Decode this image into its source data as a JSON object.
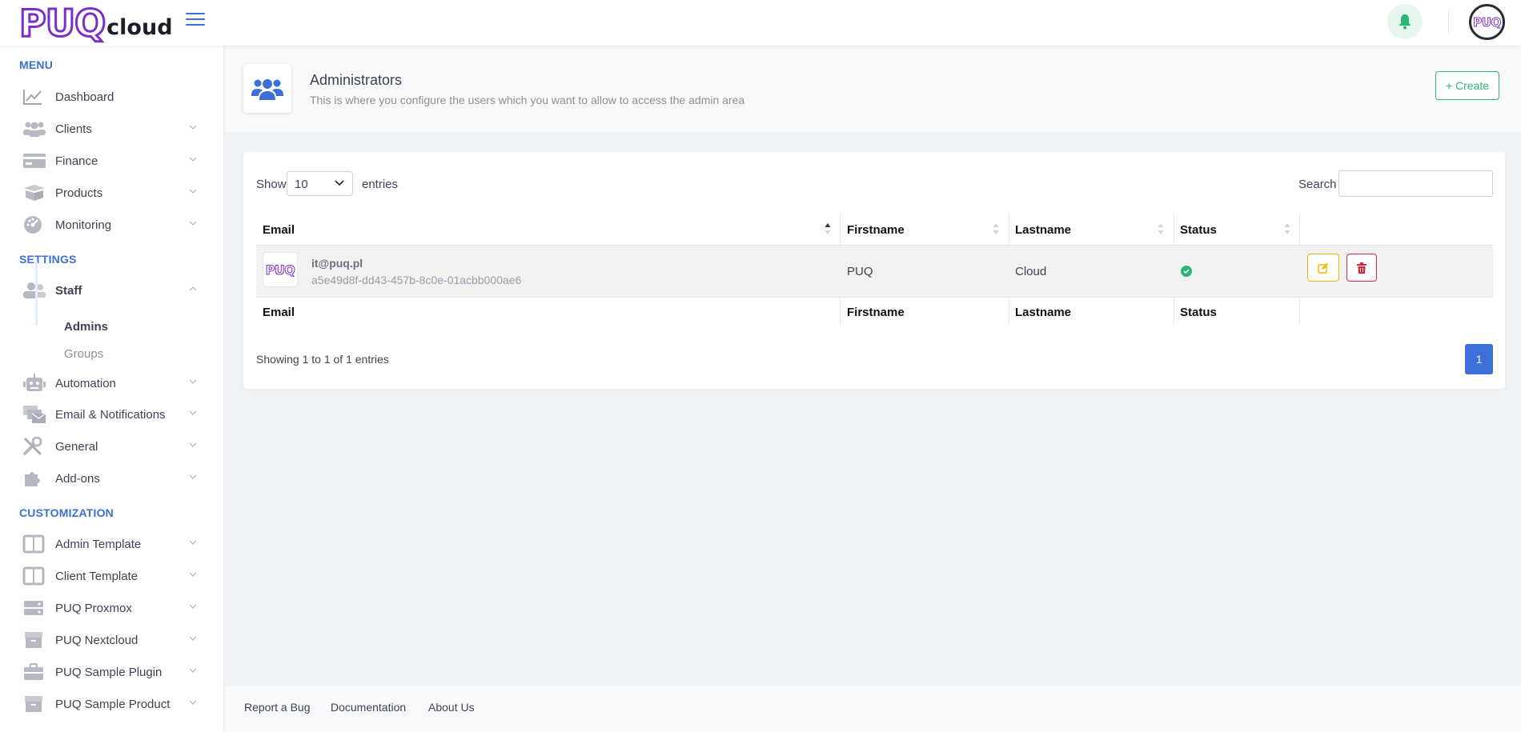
{
  "header": {
    "logo_main": "PUQ",
    "logo_sub": "cloud",
    "avatar_text": "PUQ"
  },
  "sidebar": {
    "sections": {
      "menu": "MENU",
      "settings": "SETTINGS",
      "customization": "CUSTOMIZATION"
    },
    "items": {
      "dashboard": "Dashboard",
      "clients": "Clients",
      "finance": "Finance",
      "products": "Products",
      "monitoring": "Monitoring",
      "staff": "Staff",
      "admins": "Admins",
      "groups": "Groups",
      "automation": "Automation",
      "email_notifications": "Email & Notifications",
      "general": "General",
      "addons": "Add-ons",
      "admin_template": "Admin Template",
      "client_template": "Client Template",
      "puq_proxmox": "PUQ Proxmox",
      "puq_nextcloud": "PUQ Nextcloud",
      "puq_sample_plugin": "PUQ Sample Plugin",
      "puq_sample_product": "PUQ Sample Product"
    }
  },
  "page": {
    "title": "Administrators",
    "subtitle": "This is where you configure the users which you want to allow to access the admin area",
    "create_label": "+ Create"
  },
  "table_controls": {
    "show_label": "Show",
    "page_size": "10",
    "entries_label": "entries",
    "search_label": "Search",
    "search_value": ""
  },
  "table": {
    "columns": [
      "Email",
      "Firstname",
      "Lastname",
      "Status"
    ],
    "rows": [
      {
        "logo": "PUQ",
        "email": "it@puq.pl",
        "uuid": "a5e49d8f-dd43-457b-8c0e-01acbb000ae6",
        "firstname": "PUQ",
        "lastname": "Cloud",
        "status": "active"
      }
    ]
  },
  "pagination": {
    "info": "Showing 1 to 1 of 1 entries",
    "current_page": "1"
  },
  "footer": {
    "links": [
      "Report a Bug",
      "Documentation",
      "About Us"
    ]
  },
  "colors": {
    "accent": "#3d6fd8",
    "brand": "#7b2fc9",
    "success": "#2bb673",
    "warning": "#f5b301",
    "danger": "#d7263d"
  }
}
